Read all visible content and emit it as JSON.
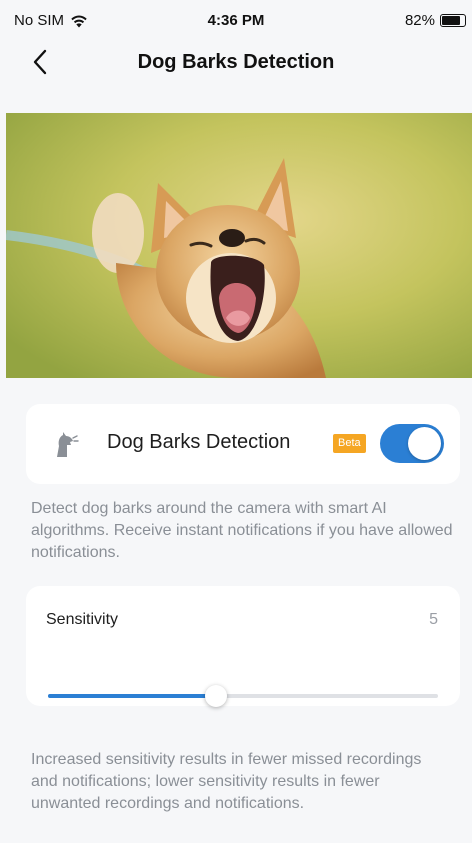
{
  "status_bar": {
    "carrier": "No SIM",
    "time": "4:36 PM",
    "battery": "82%",
    "battery_level": 0.82
  },
  "nav": {
    "title": "Dog Barks Detection",
    "back_icon": "chevron-left-icon"
  },
  "hero": {
    "image": "barking-dog-photo"
  },
  "detection": {
    "label": "Dog Barks Detection",
    "badge": "Beta",
    "icon": "dog-icon",
    "enabled": true,
    "description": "Detect dog barks around the camera with smart AI algorithms. Receive instant notifications if you have allowed notifications."
  },
  "sensitivity": {
    "label": "Sensitivity",
    "value": "5",
    "level_fraction": 0.43,
    "description": "Increased sensitivity results in fewer missed recordings and notifications; lower sensitivity results in fewer unwanted recordings and notifications."
  },
  "colors": {
    "accent": "#2b7fd4",
    "badge": "#f5a623",
    "background": "#f6f7f9"
  }
}
